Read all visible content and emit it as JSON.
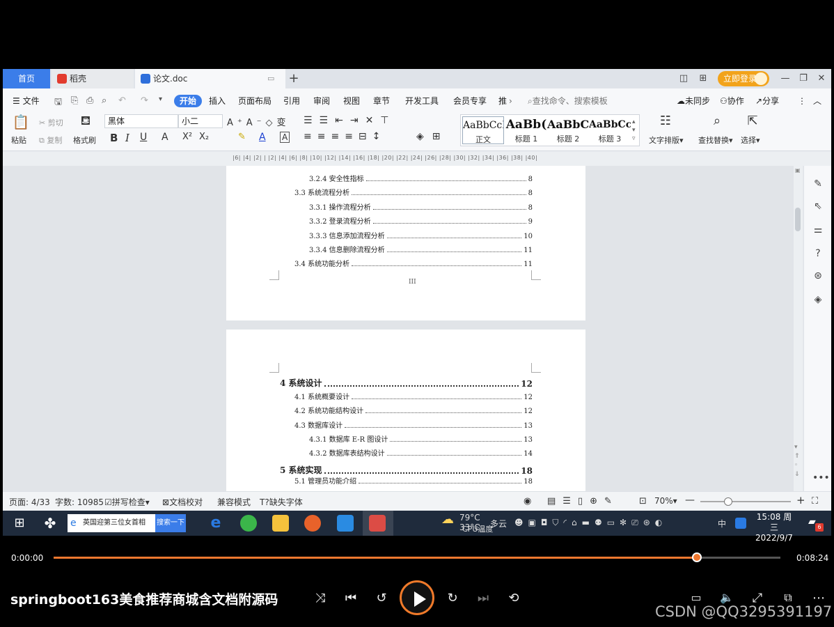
{
  "window": {
    "tabs": {
      "home": "首页",
      "daoke": "稻壳",
      "doc": "论文.doc"
    },
    "login_label": "立即登录"
  },
  "menubar": {
    "file": "文件",
    "items": [
      "开始",
      "插入",
      "页面布局",
      "引用",
      "审阅",
      "视图",
      "章节",
      "开发工具",
      "会员专享",
      "推"
    ],
    "search_placeholder": "查找命令、搜索模板",
    "sync": "未同步",
    "collab": "协作",
    "share": "分享"
  },
  "ribbon": {
    "paste": "粘贴",
    "cut": "剪切",
    "copy": "复制",
    "format_painter": "格式刷",
    "font_name": "黑体",
    "font_size": "小二",
    "styles": [
      {
        "sample": "AaBbCcI",
        "name": "正文"
      },
      {
        "sample": "AaBb(",
        "name": "标题 1"
      },
      {
        "sample": "AaBbC",
        "name": "标题 2"
      },
      {
        "sample": "AaBbCcl",
        "name": "标题 3"
      }
    ],
    "text_layout": "文字排版",
    "find_replace": "查找替换",
    "select": "选择"
  },
  "ruler_text": "|6| |4| |2| | |2| |4| |6| |8| |10| |12| |14| |16| |18| |20| |22| |24| |26| |28| |30| |32| |34| |36| |38| |40|",
  "page1": {
    "entries": [
      {
        "label": "3.2.4  安全性指标",
        "page": "8",
        "level": 3
      },
      {
        "label": "3.3 系统流程分析",
        "page": "8",
        "level": 2
      },
      {
        "label": "3.3.1  操作流程分析",
        "page": "8",
        "level": 3
      },
      {
        "label": "3.3.2  登录流程分析",
        "page": "9",
        "level": 3
      },
      {
        "label": "3.3.3  信息添加流程分析",
        "page": "10",
        "level": 3
      },
      {
        "label": "3.3.4  信息删除流程分析",
        "page": "11",
        "level": 3
      },
      {
        "label": "3.4 系统功能分析",
        "page": "11",
        "level": 2
      }
    ],
    "page_number": "III"
  },
  "page2": {
    "entries": [
      {
        "label": "4  系统设计",
        "page": "12",
        "level": 1
      },
      {
        "label": "4.1 系统概要设计",
        "page": "12",
        "level": 2
      },
      {
        "label": "4.2 系统功能结构设计",
        "page": "12",
        "level": 2
      },
      {
        "label": "4.3 数据库设计",
        "page": "13",
        "level": 2
      },
      {
        "label": "4.3.1  数据库 E-R 图设计",
        "page": "13",
        "level": 3
      },
      {
        "label": "4.3.2  数据库表结构设计",
        "page": "14",
        "level": 3
      },
      {
        "label": "5  系统实现",
        "page": "18",
        "level": 1
      },
      {
        "label": "5.1 管理员功能介绍",
        "page": "18",
        "level": 2
      }
    ]
  },
  "statusbar": {
    "page": "页面: 4/33",
    "words": "字数: 10985",
    "spellcheck": "拼写检查",
    "proofread": "文档校对",
    "compat": "兼容模式",
    "missing_font": "缺失字体",
    "zoom": "70%"
  },
  "taskbar": {
    "search_text": "英国迎第三位女首相",
    "search_button": "搜索一下",
    "weather_temp": "33°C",
    "weather_text": "多云",
    "cpu_temp": "79°C",
    "cpu_label": "CPU温度",
    "ime": "中",
    "time": "15:08 周三",
    "date": "2022/9/7",
    "notif_count": "6"
  },
  "player": {
    "current_time": "0:00:00",
    "total_time": "0:08:24",
    "progress_fraction": 0.885,
    "title": "springboot163美食推荐商城含文档附源码",
    "watermark": "CSDN @QQ3295391197",
    "accent_color": "#f0782f"
  }
}
